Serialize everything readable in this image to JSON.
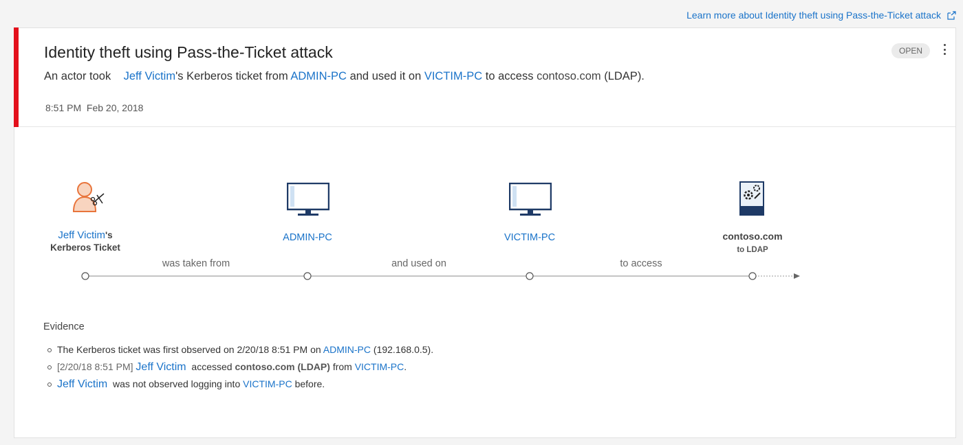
{
  "top_link": {
    "label": "Learn more about Identity theft using Pass-the-Ticket attack",
    "icon": "external-link-icon"
  },
  "alert": {
    "title": "Identity theft using Pass-the-Ticket attack",
    "status": "OPEN",
    "severity_color": "#e3101b",
    "description": {
      "prefix": "An actor took",
      "user": "Jeff Victim",
      "mid1": "'s Kerberos ticket from",
      "source": "ADMIN-PC",
      "mid2": "and used it on",
      "target": "VICTIM-PC",
      "mid3": "to access",
      "resource": "contoso.com",
      "suffix": "(LDAP)."
    },
    "time": "8:51 PM",
    "date": "Feb 20, 2018"
  },
  "graph": {
    "nodes": [
      {
        "link": "Jeff Victim",
        "link_suffix": "'s",
        "sub": "Kerberos Ticket",
        "icon": "user-scissors-icon"
      },
      {
        "link": "ADMIN-PC",
        "icon": "monitor-icon"
      },
      {
        "link": "VICTIM-PC",
        "icon": "monitor-icon"
      },
      {
        "label": "contoso.com",
        "sub": "to LDAP",
        "icon": "server-gears-icon"
      }
    ],
    "edges": [
      "was taken from",
      "and used on",
      "to access"
    ]
  },
  "evidence": {
    "title": "Evidence",
    "items": [
      {
        "text1": "The Kerberos ticket was first observed on 2/20/18 8:51 PM on",
        "link1": "ADMIN-PC",
        "text2": "(192.168.0.5)."
      },
      {
        "prefix": "[2/20/18 8:51 PM]",
        "link1": "Jeff Victim",
        "text1": "accessed",
        "bold1": "contoso.com (LDAP)",
        "text2": "from",
        "link2": "VICTIM-PC",
        "text3": "."
      },
      {
        "link1": "Jeff Victim",
        "text1": "was not observed logging into",
        "link2": "VICTIM-PC",
        "text2": "before."
      }
    ]
  }
}
